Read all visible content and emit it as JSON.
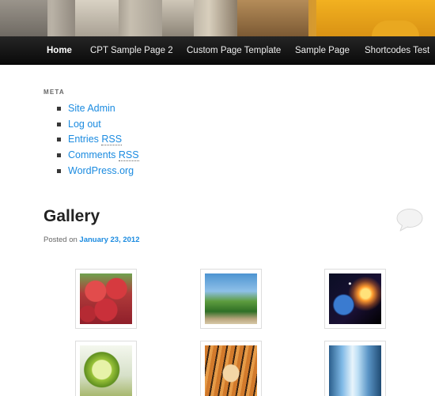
{
  "nav": {
    "items": [
      {
        "label": "Home",
        "active": true
      },
      {
        "label": "CPT Sample Page 2",
        "active": false
      },
      {
        "label": "Custom Page Template",
        "active": false
      },
      {
        "label": "Sample Page",
        "active": false
      },
      {
        "label": "Shortcodes Test",
        "active": false
      }
    ]
  },
  "meta": {
    "title": "META",
    "links": [
      {
        "text": "Site Admin"
      },
      {
        "text": "Log out"
      },
      {
        "text_pre": "Entries ",
        "abbr": "RSS"
      },
      {
        "text_pre": "Comments ",
        "abbr": "RSS"
      },
      {
        "text": "WordPress.org"
      }
    ]
  },
  "post": {
    "title": "Gallery",
    "posted_on": "Posted on ",
    "date": "January 23, 2012"
  },
  "gallery": {
    "items": [
      {
        "icon": "raspberries-image"
      },
      {
        "icon": "palm-beach-image"
      },
      {
        "icon": "planet-image"
      },
      {
        "icon": "lime-image"
      },
      {
        "icon": "tiger-image"
      },
      {
        "icon": "waterfall-image"
      }
    ]
  },
  "colors": {
    "link": "#1b8be0",
    "nav_bg": "#111111",
    "text": "#373737"
  }
}
